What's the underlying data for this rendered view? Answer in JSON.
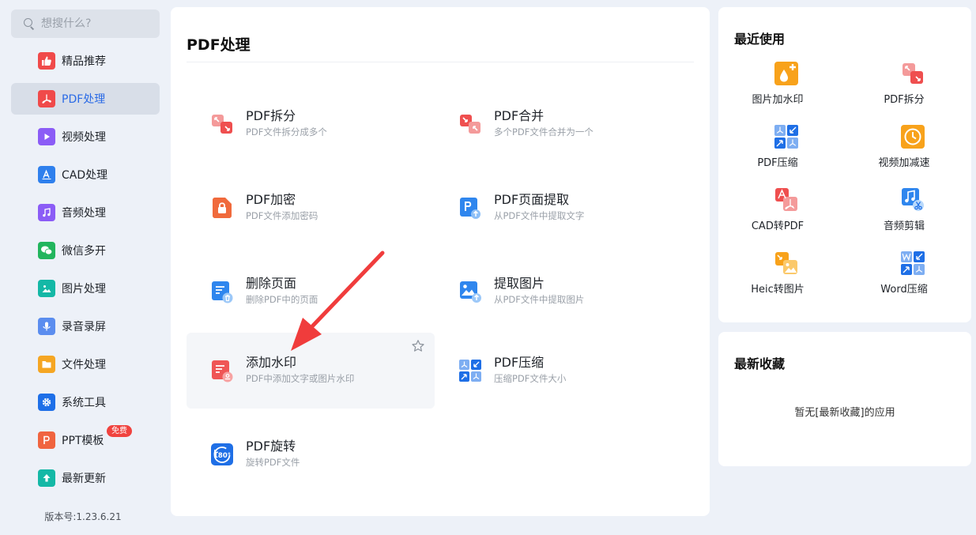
{
  "search": {
    "placeholder": "想搜什么?"
  },
  "sidebar": {
    "items": [
      {
        "label": "精品推荐",
        "icon": "thumbs-up-icon",
        "color": "#f04a4a"
      },
      {
        "label": "PDF处理",
        "icon": "pdf-icon",
        "color": "#f04a4a"
      },
      {
        "label": "视频处理",
        "icon": "video-play-icon",
        "color": "#8b5cf6"
      },
      {
        "label": "CAD处理",
        "icon": "cad-icon",
        "color": "#2f80ed"
      },
      {
        "label": "音频处理",
        "icon": "music-icon",
        "color": "#8b5cf6"
      },
      {
        "label": "微信多开",
        "icon": "wechat-icon",
        "color": "#22b55d"
      },
      {
        "label": "图片处理",
        "icon": "image-icon",
        "color": "#14b8a6"
      },
      {
        "label": "录音录屏",
        "icon": "microphone-icon",
        "color": "#5b8def"
      },
      {
        "label": "文件处理",
        "icon": "folder-icon",
        "color": "#f5a623"
      },
      {
        "label": "系统工具",
        "icon": "gear-icon",
        "color": "#1e6fe8"
      },
      {
        "label": "PPT模板",
        "icon": "ppt-icon",
        "color": "#f0643f",
        "badge": "免费"
      },
      {
        "label": "最新更新",
        "icon": "upload-icon",
        "color": "#14b8a6"
      }
    ],
    "version": "版本号:1.23.6.21"
  },
  "main": {
    "title": "PDF处理",
    "tools": [
      {
        "name": "PDF拆分",
        "desc": "PDF文件拆分成多个",
        "icon": "pdf-split-icon"
      },
      {
        "name": "PDF合并",
        "desc": "多个PDF文件合并为一个",
        "icon": "pdf-merge-icon"
      },
      {
        "name": "PDF加密",
        "desc": "PDF文件添加密码",
        "icon": "pdf-lock-icon"
      },
      {
        "name": "PDF页面提取",
        "desc": "从PDF文件中提取文字",
        "icon": "pdf-page-extract-icon"
      },
      {
        "name": "删除页面",
        "desc": "删除PDF中的页面",
        "icon": "delete-page-icon"
      },
      {
        "name": "提取图片",
        "desc": "从PDF文件中提取图片",
        "icon": "extract-image-icon"
      },
      {
        "name": "添加水印",
        "desc": "PDF中添加文字或图片水印",
        "icon": "watermark-icon",
        "hover": true
      },
      {
        "name": "PDF压缩",
        "desc": "压缩PDF文件大小",
        "icon": "pdf-compress-icon"
      },
      {
        "name": "PDF旋转",
        "desc": "旋转PDF文件",
        "icon": "rotate-180-icon"
      }
    ]
  },
  "recent": {
    "title": "最近使用",
    "items": [
      {
        "label": "图片加水印",
        "icon": "image-watermark-icon"
      },
      {
        "label": "PDF拆分",
        "icon": "pdf-split-icon"
      },
      {
        "label": "PDF压缩",
        "icon": "pdf-compress-icon"
      },
      {
        "label": "视频加减速",
        "icon": "video-speed-icon"
      },
      {
        "label": "CAD转PDF",
        "icon": "cad-to-pdf-icon"
      },
      {
        "label": "音频剪辑",
        "icon": "audio-cut-icon"
      },
      {
        "label": "Heic转图片",
        "icon": "heic-to-image-icon"
      },
      {
        "label": "Word压缩",
        "icon": "word-compress-icon"
      }
    ]
  },
  "favorites": {
    "title": "最新收藏",
    "empty": "暂无[最新收藏]的应用"
  },
  "colors": {
    "accent": "#2b6be6",
    "red": "#f04a4a",
    "orange": "#f5a623",
    "blue": "#1e6fe8",
    "annotation_arrow": "#f03c3c"
  }
}
